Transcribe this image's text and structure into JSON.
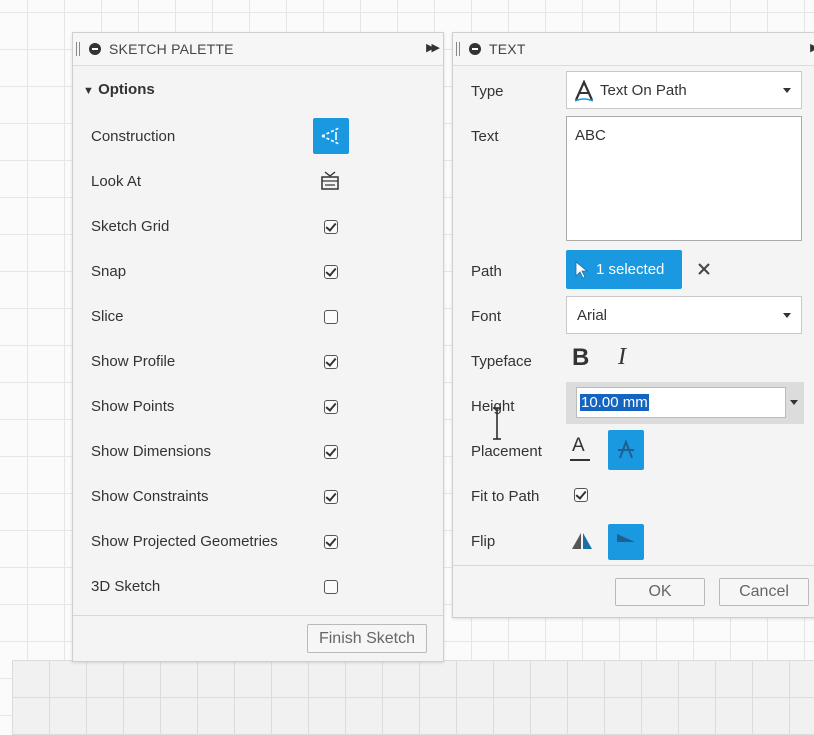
{
  "sketch_palette": {
    "title": "SKETCH PALETTE",
    "section_label": "Options",
    "rows": [
      {
        "label": "Construction",
        "control": "button"
      },
      {
        "label": "Look At",
        "control": "icon"
      },
      {
        "label": "Sketch Grid",
        "checked": true
      },
      {
        "label": "Snap",
        "checked": true
      },
      {
        "label": "Slice",
        "checked": false
      },
      {
        "label": "Show Profile",
        "checked": true
      },
      {
        "label": "Show Points",
        "checked": true
      },
      {
        "label": "Show Dimensions",
        "checked": true
      },
      {
        "label": "Show Constraints",
        "checked": true
      },
      {
        "label": "Show Projected Geometries",
        "checked": true
      },
      {
        "label": "3D Sketch",
        "checked": false
      }
    ],
    "finish_label": "Finish Sketch"
  },
  "text_dialog": {
    "title": "TEXT",
    "type_label": "Type",
    "type_value": "Text On Path",
    "text_label": "Text",
    "text_value": "ABC",
    "path_label": "Path",
    "path_value": "1 selected",
    "font_label": "Font",
    "font_value": "Arial",
    "typeface_label": "Typeface",
    "bold_glyph": "B",
    "italic_glyph": "I",
    "height_label": "Height",
    "height_value": "10.00 mm",
    "placement_label": "Placement",
    "placement_glyph": "A",
    "fit_label": "Fit to Path",
    "fit_checked": true,
    "flip_label": "Flip",
    "ok_label": "OK",
    "cancel_label": "Cancel"
  },
  "colors": {
    "accent": "#1a99e0",
    "panel_bg": "#f4f4f4"
  },
  "icons": [
    "collapse-icon",
    "expand-icon",
    "construction-icon",
    "look-at-icon",
    "cursor-icon",
    "clear-icon",
    "text-on-path-icon",
    "bold-icon",
    "italic-icon",
    "placement-icon",
    "flip-icon"
  ]
}
